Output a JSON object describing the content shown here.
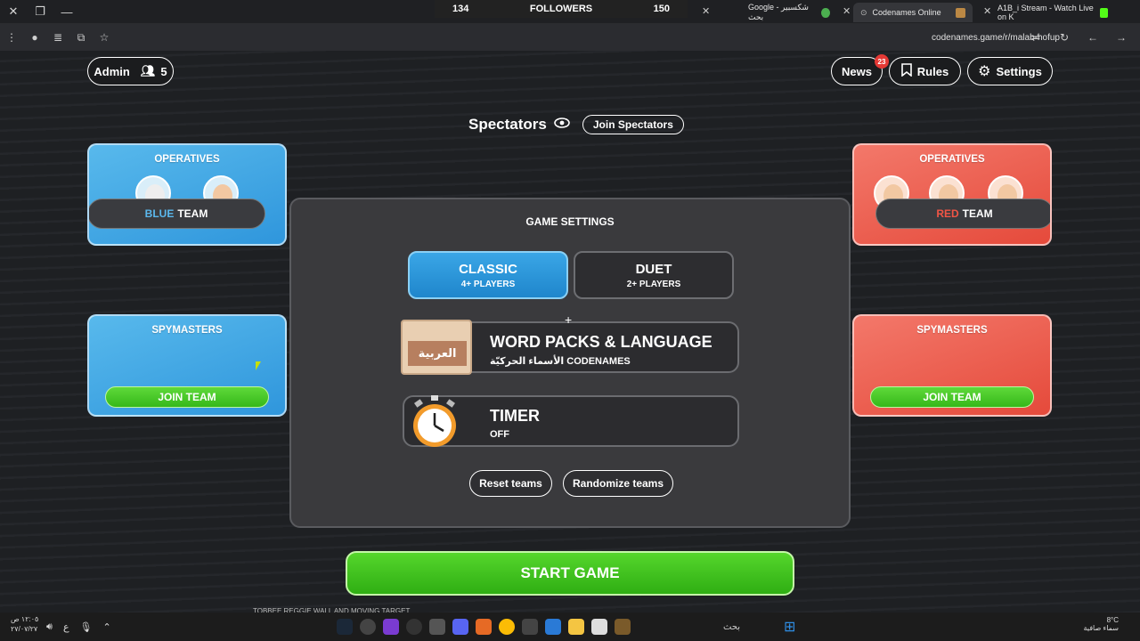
{
  "browser": {
    "followers": {
      "left": "134",
      "label": "FOLLOWERS",
      "right": "150"
    },
    "tabs": [
      {
        "label": "Google - شكسبير بحث"
      },
      {
        "label": "Codenames Online"
      },
      {
        "label": "A1B_i Stream - Watch Live on K"
      }
    ],
    "url": "codenames.game/r/malab-hofup"
  },
  "header": {
    "admin_label": "Admin",
    "player_count": "5",
    "news_label": "News",
    "news_badge": "23",
    "rules_label": "Rules",
    "settings_label": "Settings"
  },
  "spectators": {
    "title": "Spectators",
    "join_label": "Join Spectators"
  },
  "blue_team": {
    "operatives_title": "OPERATIVES",
    "team_name_color": "BLUE",
    "team_name_rest": "TEAM",
    "spymasters_title": "SPYMASTERS",
    "join_label": "JOIN TEAM",
    "color": "#2f96dc"
  },
  "red_team": {
    "operatives_title": "OPERATIVES",
    "team_name_color": "RED",
    "team_name_rest": "TEAM",
    "spymasters_title": "SPYMASTERS",
    "join_label": "JOIN TEAM",
    "color": "#e54a3b"
  },
  "game_settings": {
    "title": "GAME SETTINGS",
    "modes": [
      {
        "name": "CLASSIC",
        "players": "4+ PLAYERS",
        "selected": true
      },
      {
        "name": "DUET",
        "players": "2+ PLAYERS",
        "selected": false
      }
    ],
    "word_packs": {
      "title": "WORD PACKS & LANGUAGE",
      "subtitle": "الأسماء الحركيّة CODENAMES",
      "icon_label": "العربية"
    },
    "timer": {
      "title": "TIMER",
      "value": "OFF"
    },
    "reset_label": "Reset teams",
    "randomize_label": "Randomize teams"
  },
  "start_label": "START GAME",
  "taskbar": {
    "time": "١٢:٠٥ ص",
    "date": "٢٧/٠٧/٢٧",
    "lang": "ع",
    "search_placeholder": "بحث",
    "temperature": "8°C",
    "weather": "سماء صافية"
  },
  "ticker": "TOBBEE REGGIE WALL AND MOVING TARGET"
}
